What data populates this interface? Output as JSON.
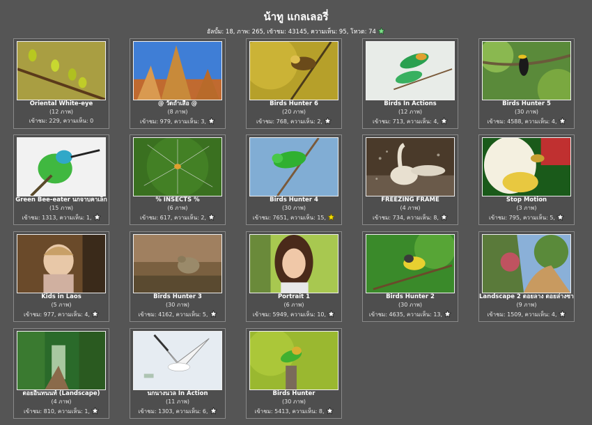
{
  "gallery": {
    "title": "น้าทู แกลเลอรี่",
    "summary": "อัลบั้ม: 18, ภาพ: 265, เข้าชม: 43145, ความเห็น: 95, โหวต: 74"
  },
  "colors": {
    "background": "#555555",
    "card_border": "#8a8a8a",
    "star_white": "#ffffff",
    "star_yellow": "#f5e000",
    "star_green": "#7fe08a"
  },
  "albums": [
    {
      "name": "Oriental White-eye",
      "count": "(12 ภาพ)",
      "stats": "เข้าชม: 229, ความเห็น: 0",
      "star": "none"
    },
    {
      "name": "@ วัดถ้ำเสือ @",
      "count": "(8 ภาพ)",
      "stats": "เข้าชม: 979, ความเห็น: 3,",
      "star": "white-star-icon"
    },
    {
      "name": "Birds Hunter 6",
      "count": "(20 ภาพ)",
      "stats": "เข้าชม: 768, ความเห็น: 2,",
      "star": "white-star-icon"
    },
    {
      "name": "Birds In Actions",
      "count": "(12 ภาพ)",
      "stats": "เข้าชม: 713, ความเห็น: 4,",
      "star": "white-star-icon"
    },
    {
      "name": "Birds Hunter 5",
      "count": "(30 ภาพ)",
      "stats": "เข้าชม: 4588, ความเห็น: 4,",
      "star": "white-star-icon"
    },
    {
      "name": "Green Bee-eater นกจาบคาเล็ก",
      "count": "(15 ภาพ)",
      "stats": "เข้าชม: 1313, ความเห็น: 1,",
      "star": "white-star-icon"
    },
    {
      "name": "% INSECTS %",
      "count": "(6 ภาพ)",
      "stats": "เข้าชม: 617, ความเห็น: 2,",
      "star": "white-star-icon"
    },
    {
      "name": "Birds Hunter 4",
      "count": "(30 ภาพ)",
      "stats": "เข้าชม: 7651, ความเห็น: 15,",
      "star": "yellow-star-icon"
    },
    {
      "name": "FREEZING FRAME",
      "count": "(4 ภาพ)",
      "stats": "เข้าชม: 734, ความเห็น: 8,",
      "star": "white-star-icon"
    },
    {
      "name": "Stop Motion",
      "count": "(3 ภาพ)",
      "stats": "เข้าชม: 795, ความเห็น: 5,",
      "star": "white-star-icon"
    },
    {
      "name": "Kids in Laos",
      "count": "(5 ภาพ)",
      "stats": "เข้าชม: 977, ความเห็น: 4,",
      "star": "white-star-icon"
    },
    {
      "name": "Birds Hunter 3",
      "count": "(30 ภาพ)",
      "stats": "เข้าชม: 4162, ความเห็น: 5,",
      "star": "white-star-icon"
    },
    {
      "name": "Portrait 1",
      "count": "(6 ภาพ)",
      "stats": "เข้าชม: 5949, ความเห็น: 10,",
      "star": "white-star-icon"
    },
    {
      "name": "Birds Hunter 2",
      "count": "(30 ภาพ)",
      "stats": "เข้าชม: 4635, ความเห็น: 13,",
      "star": "white-star-icon"
    },
    {
      "name": "Landscape 2 ดอยลาง ดอยล่างซาง",
      "count": "(9 ภาพ)",
      "stats": "เข้าชม: 1509, ความเห็น: 4,",
      "star": "white-star-icon"
    },
    {
      "name": "ดอยอินทนนท์ (Landscape)",
      "count": "(4 ภาพ)",
      "stats": "เข้าชม: 810, ความเห็น: 1,",
      "star": "white-star-icon"
    },
    {
      "name": "นกนางนวล In Action",
      "count": "(11 ภาพ)",
      "stats": "เข้าชม: 1303, ความเห็น: 6,",
      "star": "white-star-icon"
    },
    {
      "name": "Birds Hunter",
      "count": "(30 ภาพ)",
      "stats": "เข้าชม: 5413, ความเห็น: 8,",
      "star": "white-star-icon"
    }
  ]
}
